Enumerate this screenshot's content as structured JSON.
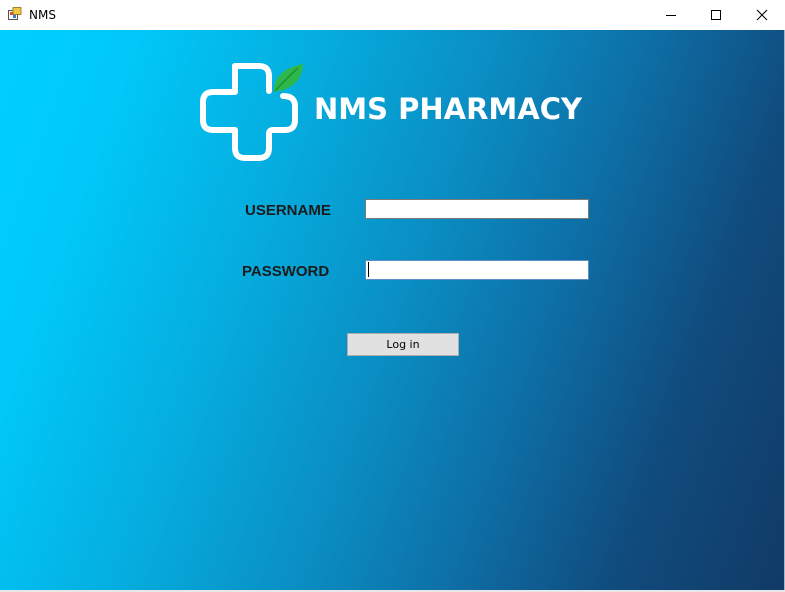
{
  "window": {
    "title": "NMS",
    "controls": {
      "minimize": "minimize",
      "maximize": "maximize",
      "close": "close"
    }
  },
  "brand": {
    "name": "NMS PHARMACY",
    "icon": "cross-with-leaf-icon",
    "colors": {
      "text": "#ffffff",
      "leaf": "#2fb84a"
    }
  },
  "form": {
    "username_label": "USERNAME",
    "username_value": "",
    "password_label": "PASSWORD",
    "password_value": "",
    "login_label": "Log in"
  },
  "colors": {
    "gradient_start": "#00cfff",
    "gradient_end": "#113a66",
    "label_text": "#1b1b1b"
  }
}
